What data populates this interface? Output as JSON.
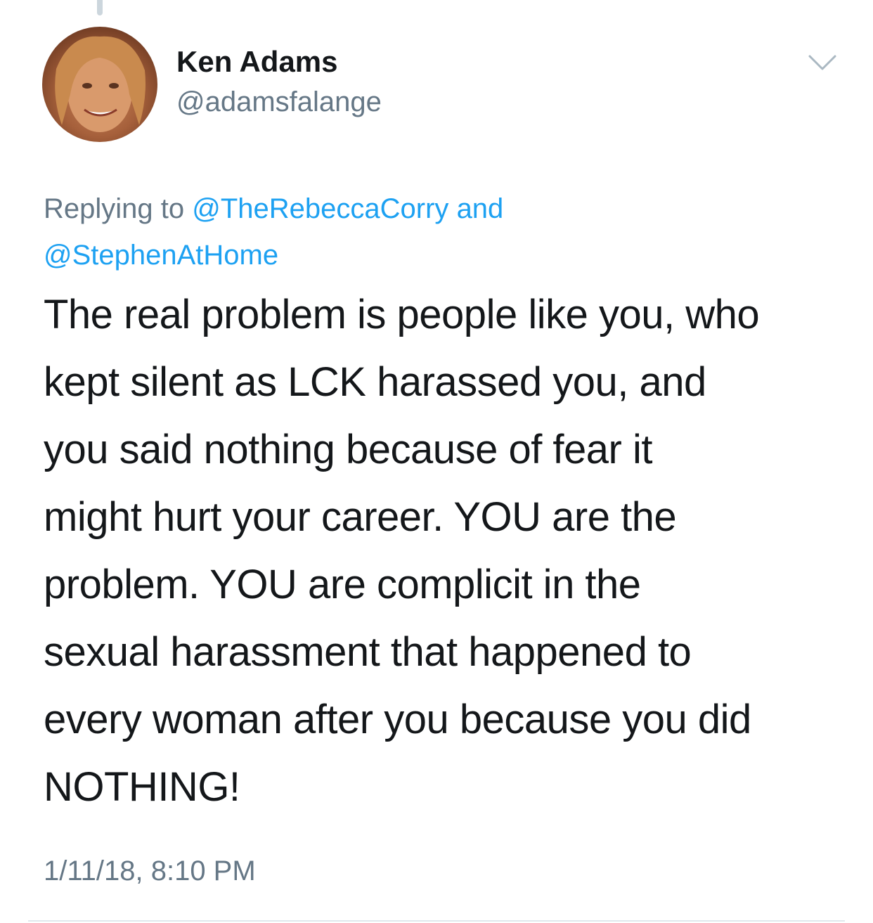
{
  "tweet": {
    "author": {
      "name": "Ken Adams",
      "handle": "@adamsfalange",
      "avatar_icon": "profile-photo"
    },
    "menu_icon": "chevron-down-icon",
    "replying": {
      "prefix": "Replying to",
      "mentions": [
        "@TheRebeccaCorry",
        "@StephenAtHome"
      ],
      "joiner": "and"
    },
    "text_lines": [
      "The real problem is people like you, who",
      "kept silent as LCK harassed you, and",
      "you said nothing because of fear it",
      "might hurt your career. YOU are the",
      "problem. YOU are complicit in the",
      "sexual harassment that happened to",
      "every woman after you because you did",
      "NOTHING!"
    ],
    "timestamp": "1/11/18, 8:10 PM"
  },
  "colors": {
    "text": "#14171a",
    "secondary": "#657786",
    "link": "#1da1f2",
    "divider": "#e1e8ed"
  }
}
